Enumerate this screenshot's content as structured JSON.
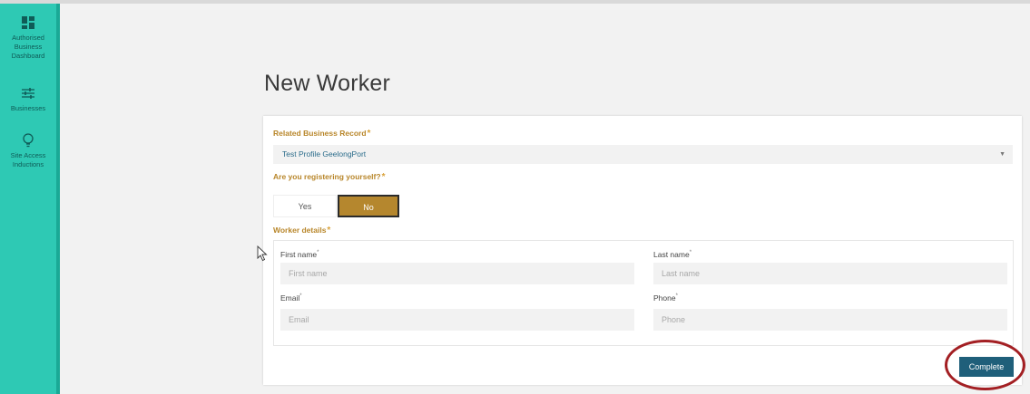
{
  "sidebar": {
    "items": [
      {
        "label": "Authorised Business Dashboard",
        "icon": "dashboard-grid-icon"
      },
      {
        "label": "Businesses",
        "icon": "sliders-icon"
      },
      {
        "label": "Site Access Inductions",
        "icon": "lightbulb-icon"
      }
    ]
  },
  "page": {
    "title": "New Worker"
  },
  "form": {
    "related_label": "Related Business Record",
    "related_value": "Test Profile GeelongPort",
    "required_mark": "*",
    "self_label": "Are you registering yourself?",
    "yes_label": "Yes",
    "no_label": "No",
    "selected": "No",
    "details_label": "Worker details",
    "first_name_label": "First name",
    "first_name_placeholder": "First name",
    "last_name_label": "Last name",
    "last_name_placeholder": "Last name",
    "email_label": "Email",
    "email_placeholder": "Email",
    "phone_label": "Phone",
    "phone_placeholder": "Phone",
    "field_required_mark": "*",
    "complete_label": "Complete"
  },
  "colors": {
    "sidebar": "#2ec9b4",
    "accent_gold": "#b5872e",
    "primary_button": "#1f5f7a",
    "highlight_ring": "#a31f23"
  }
}
